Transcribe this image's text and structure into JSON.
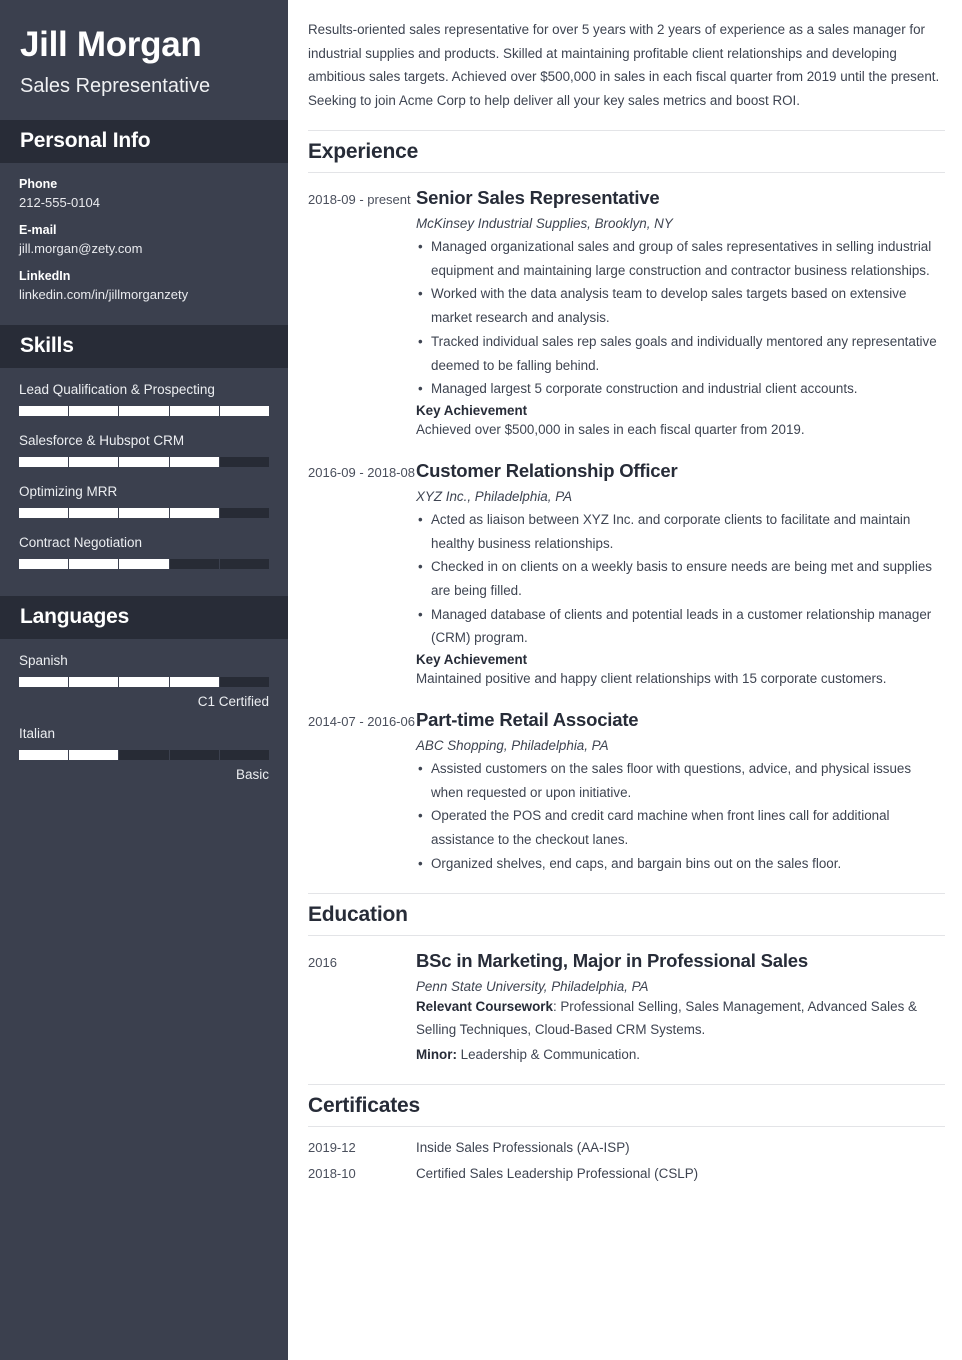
{
  "colors": {
    "sidebar_bg": "#3b404e",
    "sidebar_header_bg": "#282c37",
    "bar_track": "#272b35",
    "bar_fill": "#ffffff",
    "heading_text": "#272c38",
    "body_text": "#3e4451",
    "rule": "#e3e4e7"
  },
  "sidebar": {
    "name": "Jill Morgan",
    "job_title": "Sales Representative",
    "personal_info": {
      "heading": "Personal Info",
      "items": [
        {
          "label": "Phone",
          "value": "212-555-0104"
        },
        {
          "label": "E-mail",
          "value": "jill.morgan@zety.com"
        },
        {
          "label": "LinkedIn",
          "value": "linkedin.com/in/jillmorganzety"
        }
      ]
    },
    "skills": {
      "heading": "Skills",
      "items": [
        {
          "label": "Lead Qualification & Prospecting",
          "level": 100
        },
        {
          "label": "Salesforce & Hubspot CRM",
          "level": 80
        },
        {
          "label": "Optimizing MRR",
          "level": 80
        },
        {
          "label": "Contract Negotiation",
          "level": 60
        }
      ]
    },
    "languages": {
      "heading": "Languages",
      "items": [
        {
          "label": "Spanish",
          "level": 80,
          "note": "C1 Certified"
        },
        {
          "label": "Italian",
          "level": 40,
          "note": "Basic"
        }
      ]
    }
  },
  "main": {
    "summary": "Results-oriented sales representative for over 5 years with 2 years of experience as a sales manager for industrial supplies and products. Skilled at maintaining profitable client relationships and developing ambitious sales targets. Achieved over $500,000 in sales in each fiscal quarter from 2019 until the present. Seeking to join Acme Corp to help deliver all your key sales metrics and boost ROI.",
    "experience": {
      "heading": "Experience",
      "entries": [
        {
          "date": "2018-09 - present",
          "title": "Senior Sales Representative",
          "subtitle": "McKinsey Industrial Supplies, Brooklyn, NY",
          "bullets": [
            "Managed organizational sales and group of sales representatives in selling industrial equipment and maintaining large construction and contractor business relationships.",
            "Worked with the data analysis team to develop sales targets based on extensive market research and analysis.",
            "Tracked individual sales rep sales goals and individually mentored any representative deemed to be falling behind.",
            "Managed largest 5 corporate construction and industrial client accounts."
          ],
          "key_achievement_label": "Key Achievement",
          "key_achievement": "Achieved over $500,000 in sales in each fiscal quarter from 2019."
        },
        {
          "date": "2016-09 - 2018-08",
          "title": "Customer Relationship Officer",
          "subtitle": "XYZ Inc., Philadelphia, PA",
          "bullets": [
            "Acted as liaison between XYZ Inc. and corporate clients to facilitate and maintain healthy business relationships.",
            "Checked in on clients on a weekly basis to ensure needs are being met and supplies are being filled.",
            "Managed database of clients and potential leads in a customer relationship manager (CRM) program."
          ],
          "key_achievement_label": "Key Achievement",
          "key_achievement": "Maintained positive and happy client relationships with 15 corporate customers."
        },
        {
          "date": "2014-07 - 2016-06",
          "title": "Part-time Retail Associate",
          "subtitle": "ABC Shopping, Philadelphia, PA",
          "bullets": [
            "Assisted customers on the sales floor with questions, advice, and physical issues when requested or upon initiative.",
            "Operated the POS and credit card machine when front lines call for additional assistance to the checkout lanes.",
            "Organized shelves, end caps, and bargain bins out on the sales floor."
          ],
          "key_achievement_label": "",
          "key_achievement": ""
        }
      ]
    },
    "education": {
      "heading": "Education",
      "date": "2016",
      "title": "BSc in Marketing, Major in Professional Sales",
      "subtitle": "Penn State University, Philadelphia, PA",
      "coursework_label": "Relevant Coursework",
      "coursework": ": Professional Selling, Sales Management, Advanced Sales & Selling Techniques, Cloud-Based CRM Systems.",
      "minor_label": "Minor:",
      "minor": " Leadership & Communication."
    },
    "certificates": {
      "heading": "Certificates",
      "rows": [
        {
          "date": "2019-12",
          "name": "Inside Sales Professionals (AA-ISP)"
        },
        {
          "date": "2018-10",
          "name": "Certified Sales Leadership Professional (CSLP)"
        }
      ]
    }
  }
}
